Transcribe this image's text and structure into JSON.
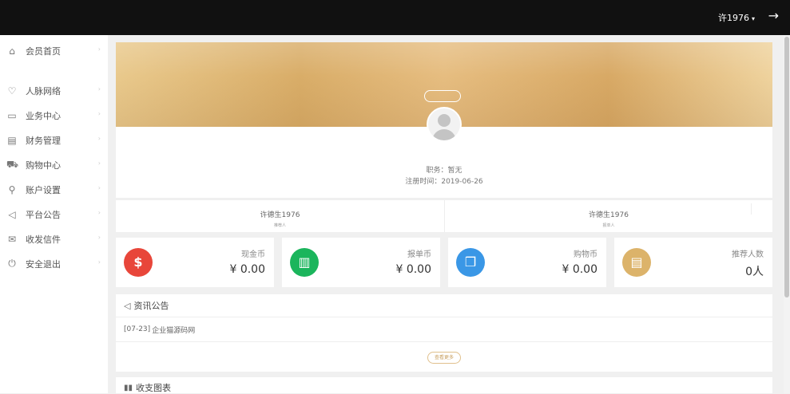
{
  "header": {
    "username": "许1976",
    "caret_icon": "▾",
    "logout_icon": "→"
  },
  "sidebar": {
    "items": [
      {
        "label": "会员首页",
        "icon": "⌂",
        "chevron": "›"
      },
      {
        "label": "人脉网络",
        "icon": "♡",
        "chevron": "›"
      },
      {
        "label": "业务中心",
        "icon": "▭",
        "chevron": "›"
      },
      {
        "label": "财务管理",
        "icon": "▤",
        "chevron": "›"
      },
      {
        "label": "购物中心",
        "icon": "⛟",
        "chevron": "›"
      },
      {
        "label": "账户设置",
        "icon": "⚲",
        "chevron": "›"
      },
      {
        "label": "平台公告",
        "icon": "◁",
        "chevron": "›"
      },
      {
        "label": "收发信件",
        "icon": "✉",
        "chevron": "›"
      },
      {
        "label": "安全退出",
        "icon": "⏻",
        "chevron": "›"
      }
    ]
  },
  "profile": {
    "position_text": "职务：暂无",
    "regdate_text": "注册时间：2019-06-26"
  },
  "people": {
    "left": {
      "name": "许德生1976",
      "role": "推荐人"
    },
    "right": {
      "name": "许德生1976",
      "role": "报单人"
    }
  },
  "stats": [
    {
      "label": "现金币",
      "value": "¥ 0.00",
      "icon": "$",
      "color": "#e8463a"
    },
    {
      "label": "报单币",
      "value": "¥ 0.00",
      "icon": "▥",
      "color": "#1bb55c"
    },
    {
      "label": "购物币",
      "value": "¥ 0.00",
      "icon": "❒",
      "color": "#3a97e6"
    },
    {
      "label": "推荐人数",
      "value": "0人",
      "icon": "▤",
      "color": "#dcb36a"
    }
  ],
  "news": {
    "title": "资讯公告",
    "icon": "◁",
    "items": [
      {
        "date": "[07-23]",
        "title": "企业猫源码网"
      }
    ],
    "more_label": "查看更多"
  },
  "chart_card": {
    "title": "收支图表",
    "icon": "▮▮"
  }
}
